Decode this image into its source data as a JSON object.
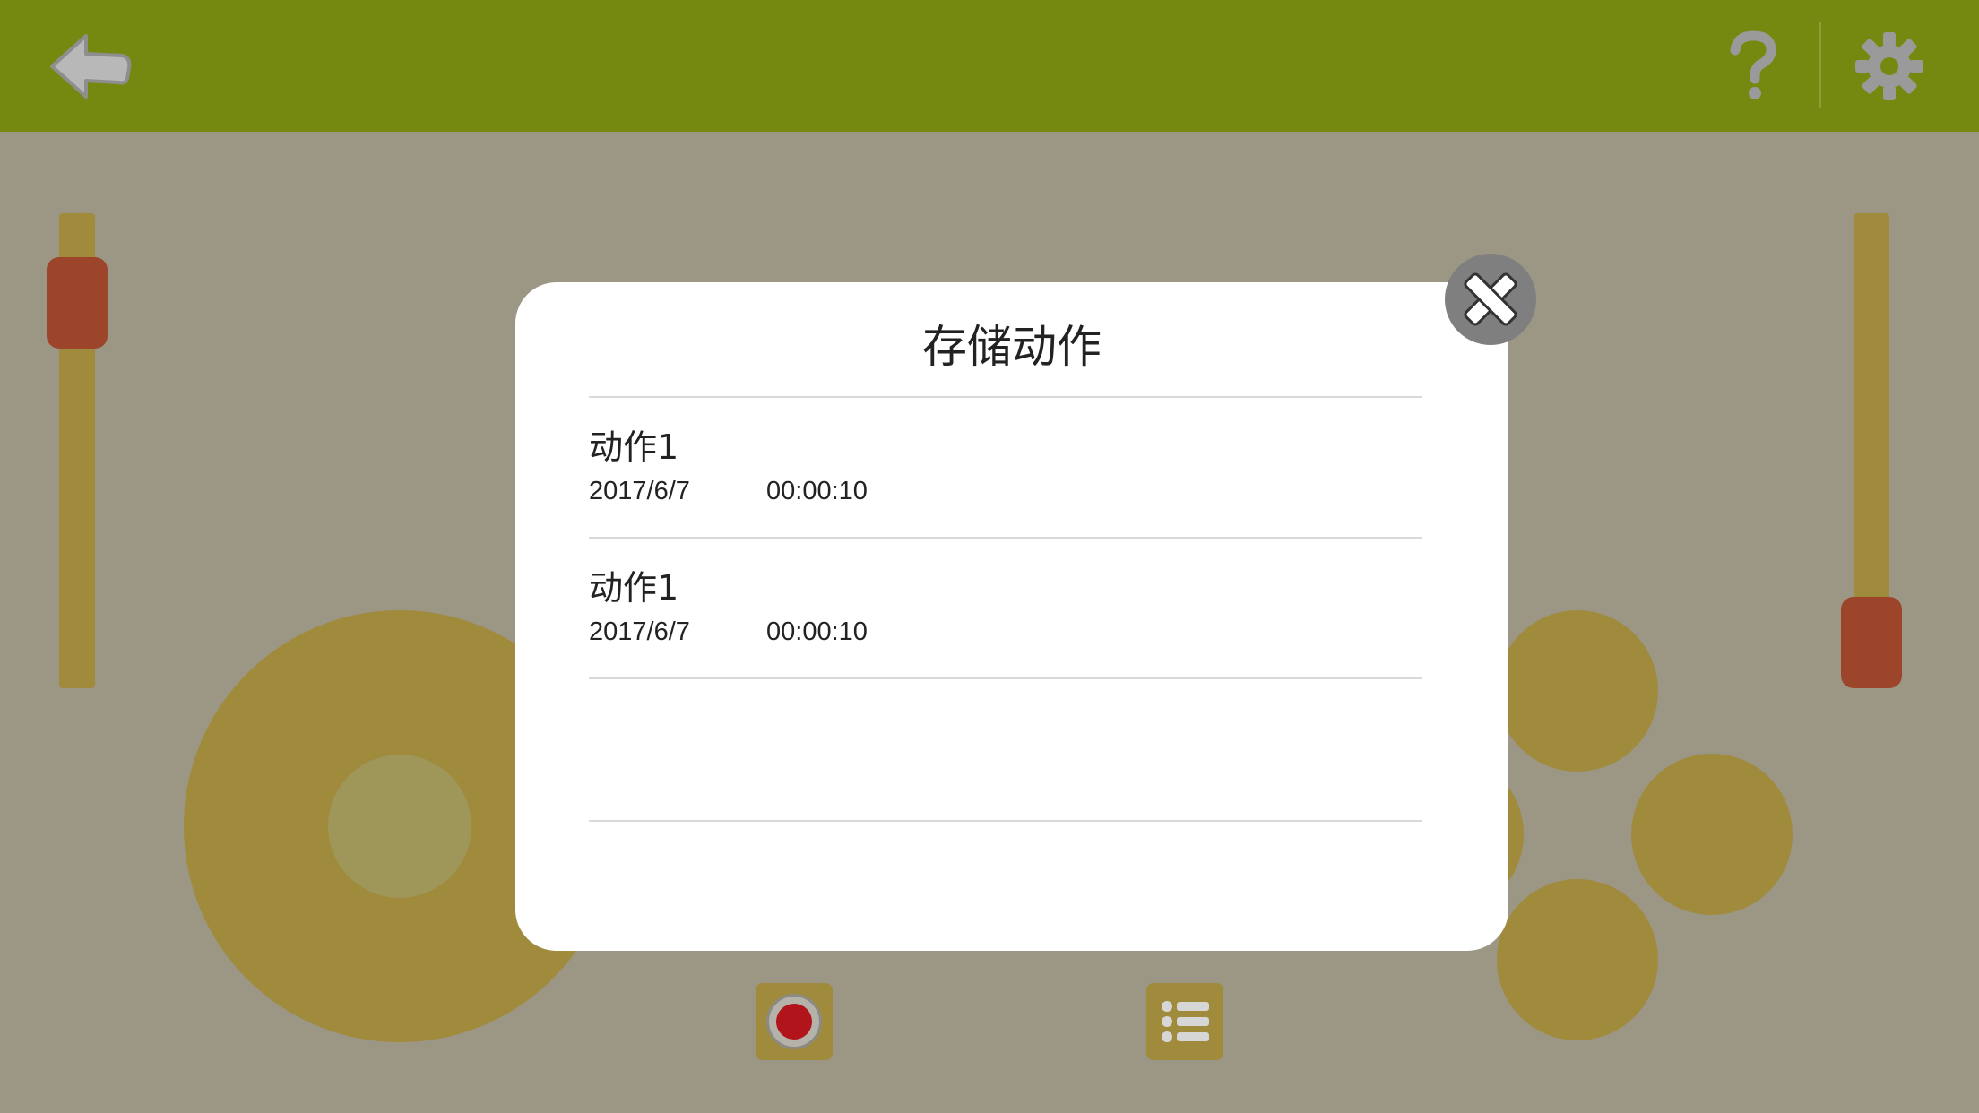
{
  "header": {
    "back_icon": "back-arrow-icon",
    "help_icon": "question-mark-icon",
    "settings_icon": "gear-icon"
  },
  "dialog": {
    "title": "存储动作",
    "close_icon": "close-x-icon",
    "items": [
      {
        "name": "动作1",
        "date": "2017/6/7",
        "duration": "00:00:10"
      },
      {
        "name": "动作1",
        "date": "2017/6/7",
        "duration": "00:00:10"
      }
    ]
  },
  "controls": {
    "left_slider_level": 0.0,
    "right_slider_level": 1.0,
    "record_icon": "record-icon",
    "list_icon": "list-icon"
  },
  "colors": {
    "topbar": "#75880f",
    "background": "#9c9685",
    "control": "#a08a3c",
    "slider_thumb": "#9c452b",
    "record_dot": "#b1141a"
  }
}
